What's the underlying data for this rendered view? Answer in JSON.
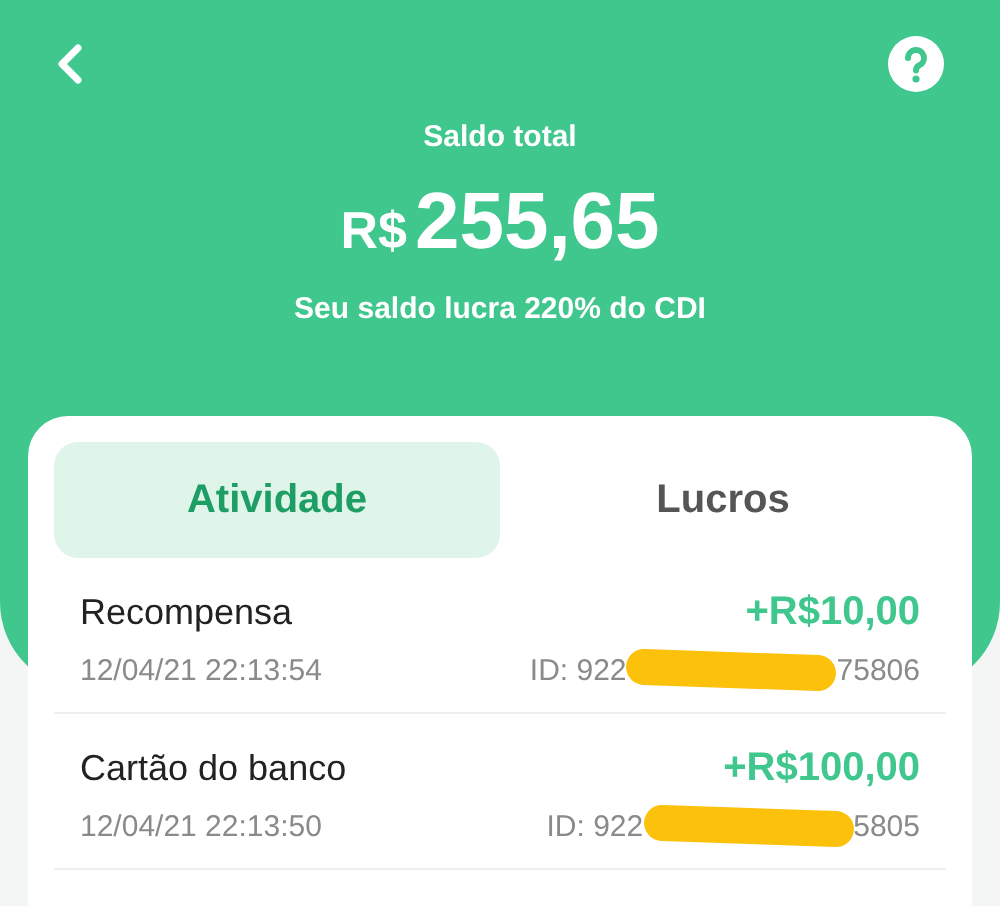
{
  "header": {
    "title": "Saldo total",
    "currency": "R$",
    "amount": "255,65",
    "subtitle": "Seu saldo lucra 220% do CDI"
  },
  "tabs": [
    {
      "label": "Atividade",
      "selected": true
    },
    {
      "label": "Lucros",
      "selected": false
    }
  ],
  "transactions": [
    {
      "name": "Recompensa",
      "amount": "+R$10,00",
      "date": "12/04/21 22:13:54",
      "id_start": "ID: 922",
      "id_end": "75806"
    },
    {
      "name": "Cartão do banco",
      "amount": "+R$100,00",
      "date": "12/04/21 22:13:50",
      "id_start": "ID: 922",
      "id_end": "5805"
    }
  ]
}
